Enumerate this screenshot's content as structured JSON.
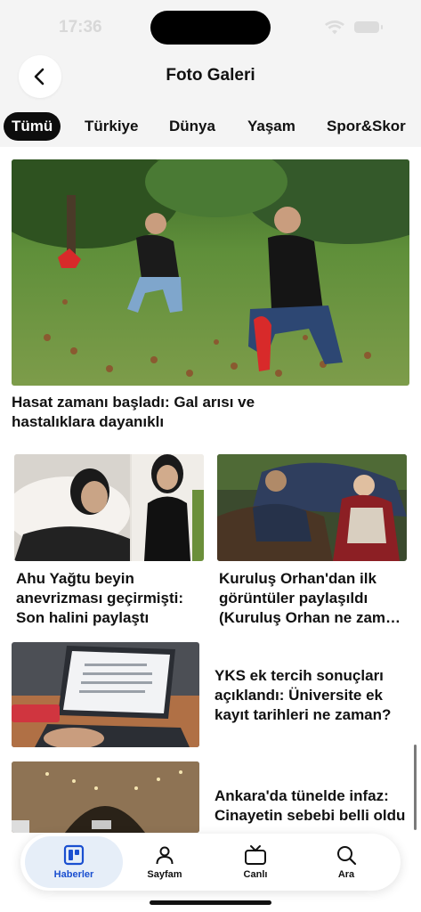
{
  "status_bar": {
    "time": "17:36"
  },
  "header": {
    "title": "Foto Galeri",
    "back_icon": "chevron-left-icon"
  },
  "tabs": [
    {
      "label": "Tümü",
      "active": true
    },
    {
      "label": "Türkiye"
    },
    {
      "label": "Dünya"
    },
    {
      "label": "Yaşam"
    },
    {
      "label": "Spor&Skor"
    }
  ],
  "hero": {
    "title": "Hasat zamanı başladı: Gal arısı ve hastalıklara dayanıklı"
  },
  "grid": [
    {
      "title": "Ahu Yağtu beyin anevrizması geçirmişti: Son halini paylaştı"
    },
    {
      "title": "Kuruluş Orhan'dan ilk görüntüler paylaşıldı (Kuruluş Orhan ne zaman başlayacak?)"
    }
  ],
  "list": [
    {
      "title": "YKS ek tercih sonuçları açıklandı: Üniversite ek kayıt tarihleri ne zaman?"
    },
    {
      "title": "Ankara'da tünelde infaz: Cinayetin sebebi belli oldu"
    }
  ],
  "tabbar": [
    {
      "label": "Haberler",
      "icon": "news-grid-icon",
      "active": true
    },
    {
      "label": "Sayfam",
      "icon": "person-icon"
    },
    {
      "label": "Canlı",
      "icon": "tv-icon"
    },
    {
      "label": "Ara",
      "icon": "search-icon"
    }
  ],
  "colors": {
    "accent": "#1a4fd0",
    "active_tab_bg": "#0d0d0d",
    "tabbar_active_bg": "#e6eef8"
  }
}
